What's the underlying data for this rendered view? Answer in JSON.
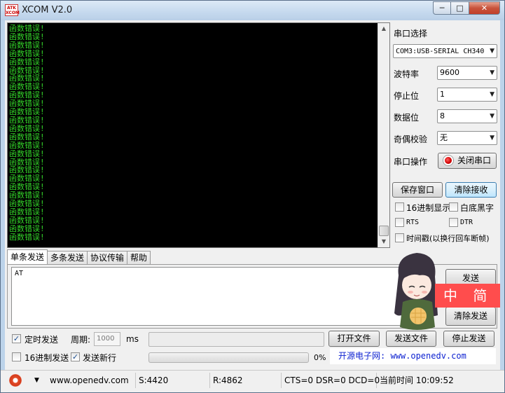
{
  "window": {
    "title": "XCOM V2.0",
    "logo_text": "ATK XCOM",
    "minimize_icon": "─",
    "maximize_icon": "□",
    "close_icon": "✕"
  },
  "receive": {
    "line_text": "函数错误!",
    "line_count": 26,
    "text_color": "#34d82a",
    "background": "#000000"
  },
  "panel": {
    "port_select_label": "串口选择",
    "port_value": "COM3:USB-SERIAL CH340",
    "baud_label": "波特率",
    "baud_value": "9600",
    "stopbits_label": "停止位",
    "stopbits_value": "1",
    "databits_label": "数据位",
    "databits_value": "8",
    "parity_label": "奇偶校验",
    "parity_value": "无",
    "port_op_label": "串口操作",
    "close_port_button": "关闭串口",
    "save_window_button": "保存窗口",
    "clear_receive_button": "清除接收",
    "hex_display_label": "16进制显示",
    "hex_display_checked": false,
    "white_bg_label": "白底黑字",
    "white_bg_checked": false,
    "rts_label": "RTS",
    "rts_checked": false,
    "dtr_label": "DTR",
    "dtr_checked": false,
    "timestamp_label": "时间戳(以换行回车断帧)",
    "timestamp_checked": false
  },
  "tabs": [
    {
      "label": "单条发送",
      "active": true
    },
    {
      "label": "多条发送",
      "active": false
    },
    {
      "label": "协议传输",
      "active": false
    },
    {
      "label": "帮助",
      "active": false
    }
  ],
  "send": {
    "text": "AT",
    "send_button": "发送",
    "clear_send_button": "清除发送",
    "banner_text": "中 简 半",
    "timed_send_label": "定时发送",
    "timed_send_checked": true,
    "period_label": "周期:",
    "period_value": "1000",
    "period_unit": "ms",
    "open_file_button": "打开文件",
    "send_file_button": "发送文件",
    "stop_send_button": "停止发送",
    "hex_send_label": "16进制发送",
    "hex_send_checked": false,
    "newline_label": "发送新行",
    "newline_checked": true,
    "progress_percent": 0,
    "progress_text": "0%",
    "url_banner": "开源电子网: www.openedv.com"
  },
  "status": {
    "site": "www.openedv.com",
    "sent": "S:4420",
    "received": "R:4862",
    "signals": "CTS=0 DSR=0 DCD=0",
    "time": "当前时间 10:09:52",
    "dropdown_icon": "▼"
  }
}
